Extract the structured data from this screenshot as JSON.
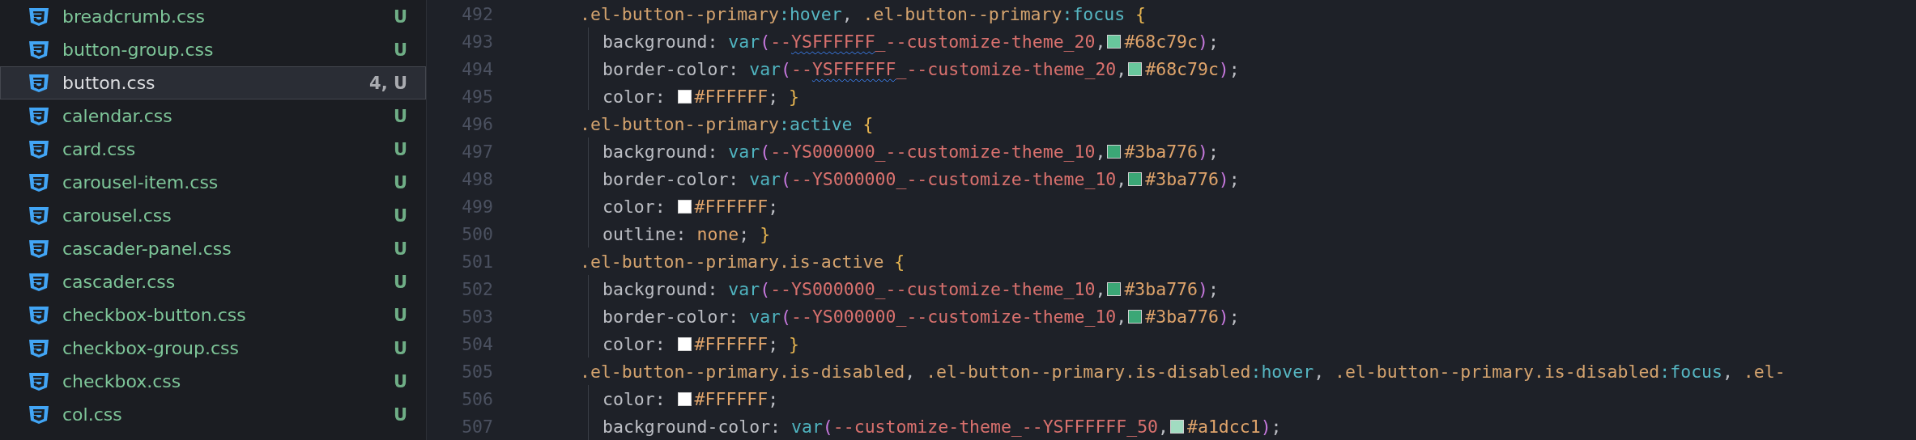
{
  "sidebar": {
    "items": [
      {
        "name": "breadcrumb.css",
        "status": "U",
        "selected": false
      },
      {
        "name": "button-group.css",
        "status": "U",
        "selected": false
      },
      {
        "name": "button.css",
        "status": "4, U",
        "selected": true
      },
      {
        "name": "calendar.css",
        "status": "U",
        "selected": false
      },
      {
        "name": "card.css",
        "status": "U",
        "selected": false
      },
      {
        "name": "carousel-item.css",
        "status": "U",
        "selected": false
      },
      {
        "name": "carousel.css",
        "status": "U",
        "selected": false
      },
      {
        "name": "cascader-panel.css",
        "status": "U",
        "selected": false
      },
      {
        "name": "cascader.css",
        "status": "U",
        "selected": false
      },
      {
        "name": "checkbox-button.css",
        "status": "U",
        "selected": false
      },
      {
        "name": "checkbox-group.css",
        "status": "U",
        "selected": false
      },
      {
        "name": "checkbox.css",
        "status": "U",
        "selected": false
      },
      {
        "name": "col.css",
        "status": "U",
        "selected": false
      }
    ]
  },
  "editor": {
    "lines": [
      {
        "number": "492",
        "kind": "rule",
        "tokens": [
          {
            "kind": "selector",
            "text": ".el-button--primary"
          },
          {
            "kind": "pseudo",
            "text": ":hover"
          },
          {
            "kind": "punct",
            "text": ", "
          },
          {
            "kind": "selector",
            "text": ".el-button--primary"
          },
          {
            "kind": "pseudo",
            "text": ":focus"
          },
          {
            "kind": "brace",
            "text": " {"
          }
        ]
      },
      {
        "number": "493",
        "kind": "decl",
        "tokens": [
          {
            "kind": "property",
            "text": "background: "
          },
          {
            "kind": "func",
            "text": "var"
          },
          {
            "kind": "paren",
            "text": "("
          },
          {
            "kind": "var",
            "text": "--"
          },
          {
            "kind": "var",
            "text": "YSFFFFFF",
            "squiggle": true
          },
          {
            "kind": "var",
            "text": "_--customize-theme_20"
          },
          {
            "kind": "punct",
            "text": ","
          },
          {
            "kind": "color",
            "text": "#68c79c",
            "color": "#68c79c"
          },
          {
            "kind": "paren",
            "text": ")"
          },
          {
            "kind": "punct",
            "text": ";"
          }
        ]
      },
      {
        "number": "494",
        "kind": "decl",
        "tokens": [
          {
            "kind": "property",
            "text": "border-color: "
          },
          {
            "kind": "func",
            "text": "var"
          },
          {
            "kind": "paren",
            "text": "("
          },
          {
            "kind": "var",
            "text": "--"
          },
          {
            "kind": "var",
            "text": "YSFFFFFF",
            "squiggle": true
          },
          {
            "kind": "var",
            "text": "_--customize-theme_20"
          },
          {
            "kind": "punct",
            "text": ","
          },
          {
            "kind": "color",
            "text": "#68c79c",
            "color": "#68c79c"
          },
          {
            "kind": "paren",
            "text": ")"
          },
          {
            "kind": "punct",
            "text": ";"
          }
        ]
      },
      {
        "number": "495",
        "kind": "decl",
        "tokens": [
          {
            "kind": "property",
            "text": "color: "
          },
          {
            "kind": "color",
            "text": "#FFFFFF",
            "color": "#ffffff"
          },
          {
            "kind": "punct",
            "text": "; "
          },
          {
            "kind": "brace",
            "text": "}"
          }
        ]
      },
      {
        "number": "496",
        "kind": "rule",
        "tokens": [
          {
            "kind": "selector",
            "text": ".el-button--primary"
          },
          {
            "kind": "pseudo",
            "text": ":active"
          },
          {
            "kind": "brace",
            "text": " {"
          }
        ]
      },
      {
        "number": "497",
        "kind": "decl",
        "tokens": [
          {
            "kind": "property",
            "text": "background: "
          },
          {
            "kind": "func",
            "text": "var"
          },
          {
            "kind": "paren",
            "text": "("
          },
          {
            "kind": "var",
            "text": "--YS000000_--customize-theme_10"
          },
          {
            "kind": "punct",
            "text": ","
          },
          {
            "kind": "color",
            "text": "#3ba776",
            "color": "#3ba776"
          },
          {
            "kind": "paren",
            "text": ")"
          },
          {
            "kind": "punct",
            "text": ";"
          }
        ]
      },
      {
        "number": "498",
        "kind": "decl",
        "tokens": [
          {
            "kind": "property",
            "text": "border-color: "
          },
          {
            "kind": "func",
            "text": "var"
          },
          {
            "kind": "paren",
            "text": "("
          },
          {
            "kind": "var",
            "text": "--YS000000_--customize-theme_10"
          },
          {
            "kind": "punct",
            "text": ","
          },
          {
            "kind": "color",
            "text": "#3ba776",
            "color": "#3ba776"
          },
          {
            "kind": "paren",
            "text": ")"
          },
          {
            "kind": "punct",
            "text": ";"
          }
        ]
      },
      {
        "number": "499",
        "kind": "decl",
        "tokens": [
          {
            "kind": "property",
            "text": "color: "
          },
          {
            "kind": "color",
            "text": "#FFFFFF",
            "color": "#ffffff"
          },
          {
            "kind": "punct",
            "text": ";"
          }
        ]
      },
      {
        "number": "500",
        "kind": "decl",
        "tokens": [
          {
            "kind": "property",
            "text": "outline: "
          },
          {
            "kind": "value",
            "text": "none"
          },
          {
            "kind": "punct",
            "text": "; "
          },
          {
            "kind": "brace",
            "text": "}"
          }
        ]
      },
      {
        "number": "501",
        "kind": "rule",
        "tokens": [
          {
            "kind": "selector",
            "text": ".el-button--primary.is-active"
          },
          {
            "kind": "brace",
            "text": " {"
          }
        ]
      },
      {
        "number": "502",
        "kind": "decl",
        "tokens": [
          {
            "kind": "property",
            "text": "background: "
          },
          {
            "kind": "func",
            "text": "var"
          },
          {
            "kind": "paren",
            "text": "("
          },
          {
            "kind": "var",
            "text": "--YS000000_--customize-theme_10"
          },
          {
            "kind": "punct",
            "text": ","
          },
          {
            "kind": "color",
            "text": "#3ba776",
            "color": "#3ba776"
          },
          {
            "kind": "paren",
            "text": ")"
          },
          {
            "kind": "punct",
            "text": ";"
          }
        ]
      },
      {
        "number": "503",
        "kind": "decl",
        "tokens": [
          {
            "kind": "property",
            "text": "border-color: "
          },
          {
            "kind": "func",
            "text": "var"
          },
          {
            "kind": "paren",
            "text": "("
          },
          {
            "kind": "var",
            "text": "--YS000000_--customize-theme_10"
          },
          {
            "kind": "punct",
            "text": ","
          },
          {
            "kind": "color",
            "text": "#3ba776",
            "color": "#3ba776"
          },
          {
            "kind": "paren",
            "text": ")"
          },
          {
            "kind": "punct",
            "text": ";"
          }
        ]
      },
      {
        "number": "504",
        "kind": "decl",
        "tokens": [
          {
            "kind": "property",
            "text": "color: "
          },
          {
            "kind": "color",
            "text": "#FFFFFF",
            "color": "#ffffff"
          },
          {
            "kind": "punct",
            "text": "; "
          },
          {
            "kind": "brace",
            "text": "}"
          }
        ]
      },
      {
        "number": "505",
        "kind": "rule",
        "tokens": [
          {
            "kind": "selector",
            "text": ".el-button--primary.is-disabled"
          },
          {
            "kind": "punct",
            "text": ", "
          },
          {
            "kind": "selector",
            "text": ".el-button--primary.is-disabled"
          },
          {
            "kind": "pseudo",
            "text": ":hover"
          },
          {
            "kind": "punct",
            "text": ", "
          },
          {
            "kind": "selector",
            "text": ".el-button--primary.is-disabled"
          },
          {
            "kind": "pseudo",
            "text": ":focus"
          },
          {
            "kind": "punct",
            "text": ", "
          },
          {
            "kind": "selector",
            "text": ".el-"
          }
        ]
      },
      {
        "number": "506",
        "kind": "decl",
        "tokens": [
          {
            "kind": "property",
            "text": "color: "
          },
          {
            "kind": "color",
            "text": "#FFFFFF",
            "color": "#ffffff"
          },
          {
            "kind": "punct",
            "text": ";"
          }
        ]
      },
      {
        "number": "507",
        "kind": "decl",
        "tokens": [
          {
            "kind": "property",
            "text": "background-color: "
          },
          {
            "kind": "func",
            "text": "var"
          },
          {
            "kind": "paren",
            "text": "("
          },
          {
            "kind": "var",
            "text": "--customize-theme_--YSFFFFFF_50"
          },
          {
            "kind": "punct",
            "text": ","
          },
          {
            "kind": "color",
            "text": "#a1dcc1",
            "color": "#a1dcc1"
          },
          {
            "kind": "paren",
            "text": ")"
          },
          {
            "kind": "punct",
            "text": ";"
          }
        ]
      }
    ]
  }
}
